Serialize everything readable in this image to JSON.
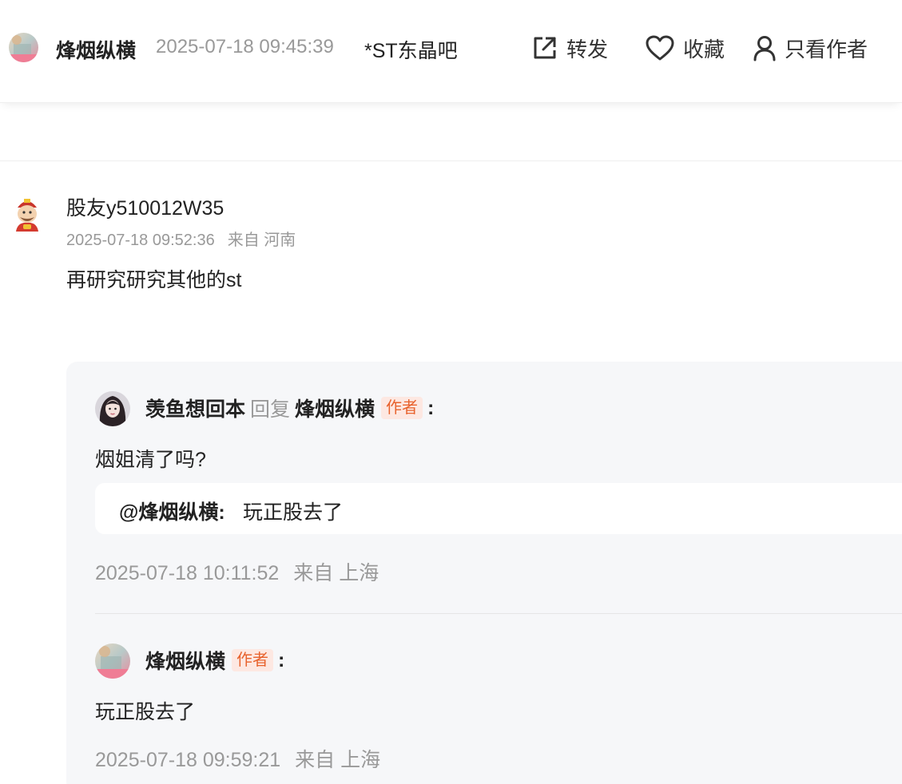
{
  "header": {
    "author": "烽烟纵横",
    "time": "2025-07-18 09:45:39",
    "board": "*ST东晶吧",
    "actions": {
      "share": "转发",
      "favorite": "收藏",
      "only_author": "只看作者"
    },
    "icons": {
      "share": "share-external-icon",
      "favorite": "heart-outline-icon",
      "only_author": "person-outline-icon"
    }
  },
  "comment": {
    "user": "股友y510012W35",
    "time": "2025-07-18 09:52:36",
    "location": "来自 河南",
    "text": "再研究研究其他的st"
  },
  "replies": [
    {
      "user": "羡鱼想回本",
      "reply_word": "回复",
      "reply_to": "烽烟纵横",
      "badge": "作者",
      "colon": ":",
      "text": "烟姐清了吗?",
      "quote_at": "@烽烟纵横:",
      "quote_text": "玩正股去了",
      "time": "2025-07-18 10:11:52",
      "location": "来自 上海"
    },
    {
      "user": "烽烟纵横",
      "badge": "作者",
      "colon": ":",
      "text": "玩正股去了",
      "time": "2025-07-18 09:59:21",
      "location": "来自 上海"
    }
  ],
  "colors": {
    "badge_bg": "#fde8e2",
    "badge_text": "#e8632e",
    "muted": "#999999",
    "reply_box_bg": "#f6f7f9"
  }
}
